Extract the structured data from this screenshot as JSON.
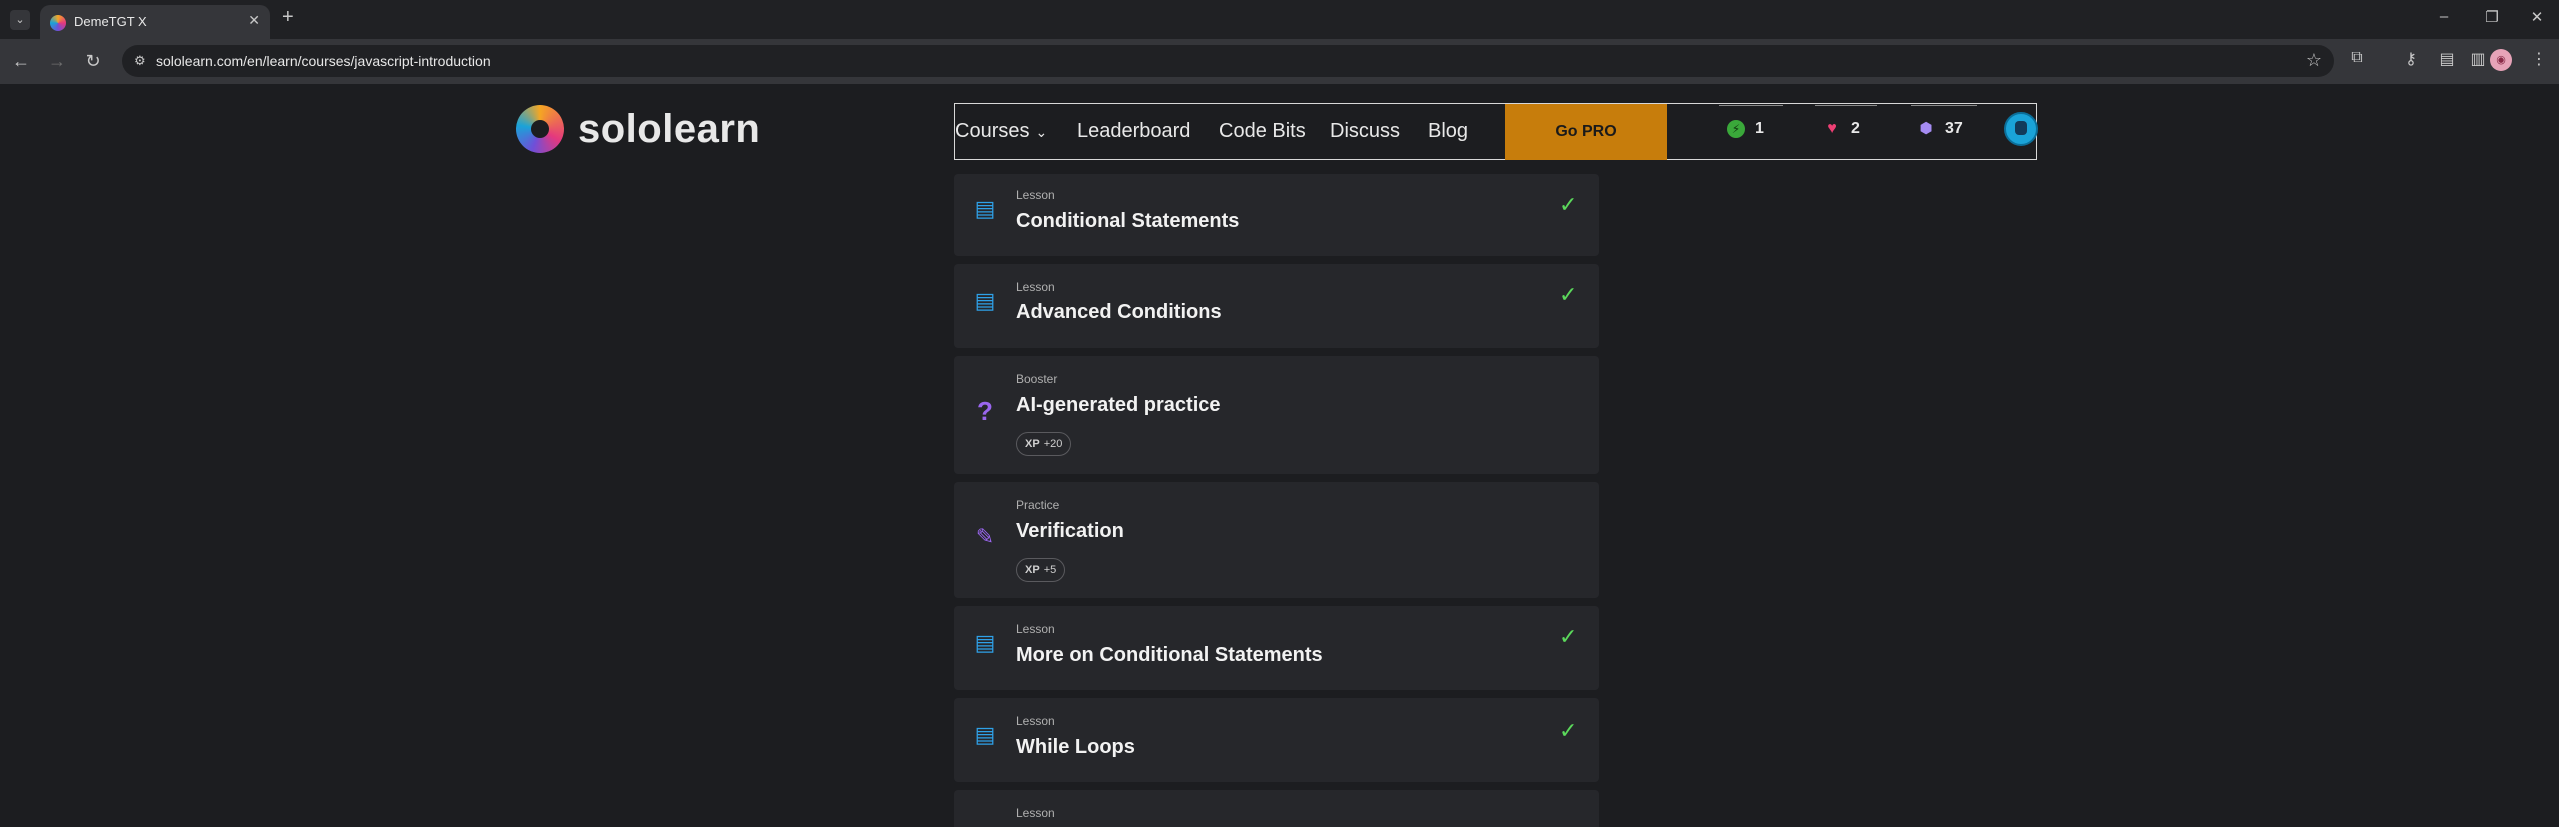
{
  "browser": {
    "tab_title": "DemeTGT X",
    "tab_close": "✕",
    "new_tab": "+",
    "url": "sololearn.com/en/learn/courses/javascript-introduction"
  },
  "site": {
    "logo_text": "sololearn",
    "nav": {
      "courses": "Courses",
      "leaderboard": "Leaderboard",
      "code_bits": "Code Bits",
      "discuss": "Discuss",
      "blog": "Blog",
      "go_pro": "Go PRO"
    },
    "stats": {
      "streak": "1",
      "hearts": "2",
      "gems": "37"
    }
  },
  "items": [
    {
      "type": "Lesson",
      "title": "Conditional Statements",
      "completed": true,
      "icon": "lesson-icon"
    },
    {
      "type": "Lesson",
      "title": "Advanced Conditions",
      "completed": true,
      "icon": "lesson-icon"
    },
    {
      "type": "Booster",
      "title": "AI-generated practice",
      "completed": false,
      "icon": "question-mark-icon",
      "xp_label": "XP",
      "xp_value": "+20"
    },
    {
      "type": "Practice",
      "title": "Verification",
      "completed": false,
      "icon": "pencil-icon",
      "xp_label": "XP",
      "xp_value": "+5"
    },
    {
      "type": "Lesson",
      "title": "More on Conditional Statements",
      "completed": true,
      "icon": "lesson-icon"
    },
    {
      "type": "Lesson",
      "title": "While Loops",
      "completed": true,
      "icon": "lesson-icon"
    },
    {
      "type": "Lesson",
      "title": "",
      "completed": false,
      "icon": "lesson-icon"
    }
  ],
  "colors": {
    "accent_pro": "#c77d0c",
    "check": "#5bd85b",
    "lesson_icon": "#2fa1e8",
    "practice_icon": "#9a66ef",
    "page_bg": "#1c1d20",
    "card_bg": "#26272b"
  }
}
